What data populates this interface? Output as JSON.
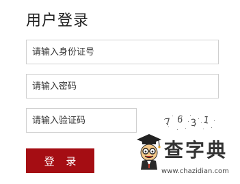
{
  "page_title": "用户登录",
  "form": {
    "id_placeholder": "请输入身份证号",
    "password_placeholder": "请输入密码",
    "captcha_placeholder": "请输入验证码",
    "captcha_text": "7631",
    "login_label": "登 录"
  },
  "watermark": {
    "brand": "查字典",
    "url": "www.chazidian.com"
  },
  "colors": {
    "login_button": "#a50d13",
    "title_text": "#222222",
    "field_border": "#cfcfcf"
  }
}
